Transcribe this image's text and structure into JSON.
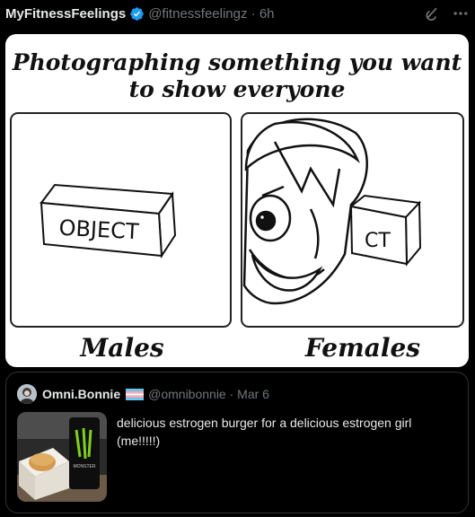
{
  "post": {
    "display_name": "MyFitnessFeelings",
    "handle_time": "@fitnessfeelingz · 6h"
  },
  "icons": {
    "verified": "verified-badge-icon",
    "grok": "grok-icon",
    "more": "more-options-icon"
  },
  "meme": {
    "title_line1": "Photographing something you want",
    "title_line2": "to show everyone",
    "left_box_label": "OBJECT",
    "right_box_label": "CT",
    "left_caption": "Males",
    "right_caption": "Females"
  },
  "quote": {
    "display_name": "Omni.Bonnie",
    "handle_time": "@omnibonnie · Mar 6",
    "text": "delicious estrogen burger for a delicious estrogen girl (me!!!!!)",
    "can_label": "MONSTER"
  },
  "colors": {
    "background": "#000000",
    "text_primary": "#e7e9ea",
    "text_secondary": "#71767b",
    "verified_blue": "#1d9bf0",
    "border": "#2f3336",
    "monster_green": "#7fd11b"
  }
}
